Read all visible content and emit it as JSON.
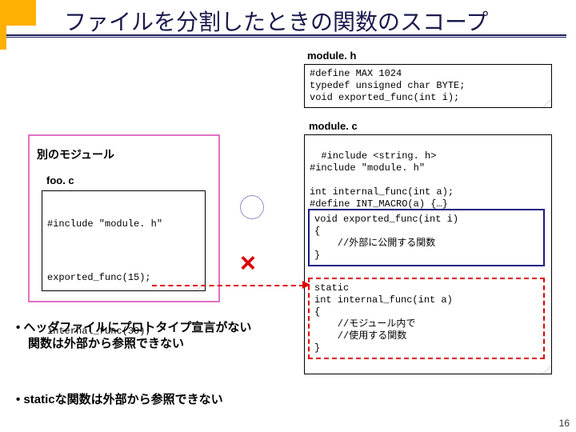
{
  "title": "ファイルを分割したときの関数のスコープ",
  "page_number": "16",
  "module_h": {
    "caption": "module. h",
    "code": "#define MAX 1024\ntypedef unsigned char BYTE;\nvoid exported_func(int i);"
  },
  "module_c": {
    "caption": "module. c",
    "top_code": "#include <string. h>\n#include \"module. h\"\n\nint internal_func(int a);\n#define INT_MACRO(a) {…}",
    "exported_code": "void exported_func(int i)\n{\n    //外部に公開する関数\n}",
    "static_code": "static\nint internal_func(int a)\n{\n    //モジュール内で\n    //使用する関数\n}"
  },
  "other_module": {
    "label": "別のモジュール"
  },
  "foo": {
    "caption": "foo. c",
    "line1": "#include \"module. h\"",
    "line2": "exported_func(15);",
    "line3": "internal_func(30);"
  },
  "bullets": {
    "b1": "• ヘッダファイルにプロトタイプ宣言がない\n　関数は外部から参照できない",
    "b2": "• staticな関数は外部から参照できない"
  },
  "marks": {
    "x": "×"
  }
}
